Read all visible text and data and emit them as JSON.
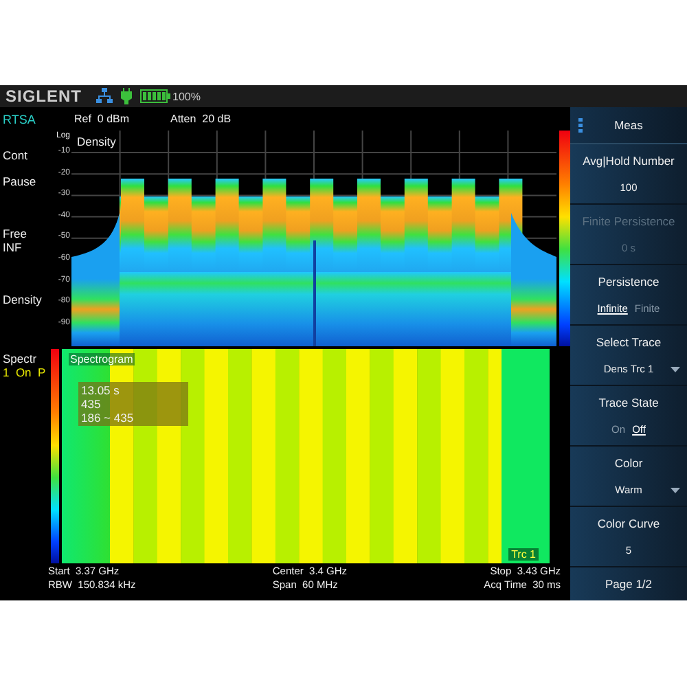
{
  "status_bar": {
    "brand": "SIGLENT",
    "battery": "100%"
  },
  "header": {
    "mode": "RTSA",
    "ref": "Ref  0 dBm",
    "atten": "Atten  20 dB"
  },
  "sidebar": {
    "sweep": "Cont",
    "pause": "Pause",
    "free": [
      "Free",
      "INF"
    ],
    "density": "Density",
    "spectr": "Spectr",
    "spectr_trace": "1  On  P"
  },
  "density_plot": {
    "title": "Density",
    "scale": "Log",
    "y_labels": [
      "-10",
      "-20",
      "-30",
      "-40",
      "-50",
      "-60",
      "-70",
      "-80",
      "-90"
    ]
  },
  "spectrogram": {
    "title": "Spectrogram",
    "readout": [
      "13.05 s",
      "435",
      "186 ~ 435"
    ],
    "trace_label": "Trc 1"
  },
  "footer": {
    "start": "Start  3.37 GHz",
    "rbw": "RBW  150.834 kHz",
    "center": "Center  3.4 GHz",
    "span": "Span  60 MHz",
    "stop": "Stop  3.43 GHz",
    "acq": "Acq Time  30 ms"
  },
  "menu": {
    "title": "Meas",
    "items": [
      {
        "kind": "value",
        "label": "Avg|Hold Number",
        "value": "100"
      },
      {
        "kind": "disabled",
        "label": "Finite Persistence",
        "value": "0 s"
      },
      {
        "kind": "toggle",
        "label": "Persistence",
        "options": [
          {
            "label": "Infinite",
            "selected": true
          },
          {
            "label": "Finite",
            "selected": false
          }
        ]
      },
      {
        "kind": "dropdown",
        "label": "Select Trace",
        "value": "Dens Trc 1"
      },
      {
        "kind": "toggle",
        "label": "Trace State",
        "options": [
          {
            "label": "On",
            "selected": false
          },
          {
            "label": "Off",
            "selected": true
          }
        ]
      },
      {
        "kind": "dropdown",
        "label": "Color",
        "value": "Warm"
      },
      {
        "kind": "value",
        "label": "Color Curve",
        "value": "5"
      }
    ],
    "page": "Page 1/2"
  }
}
